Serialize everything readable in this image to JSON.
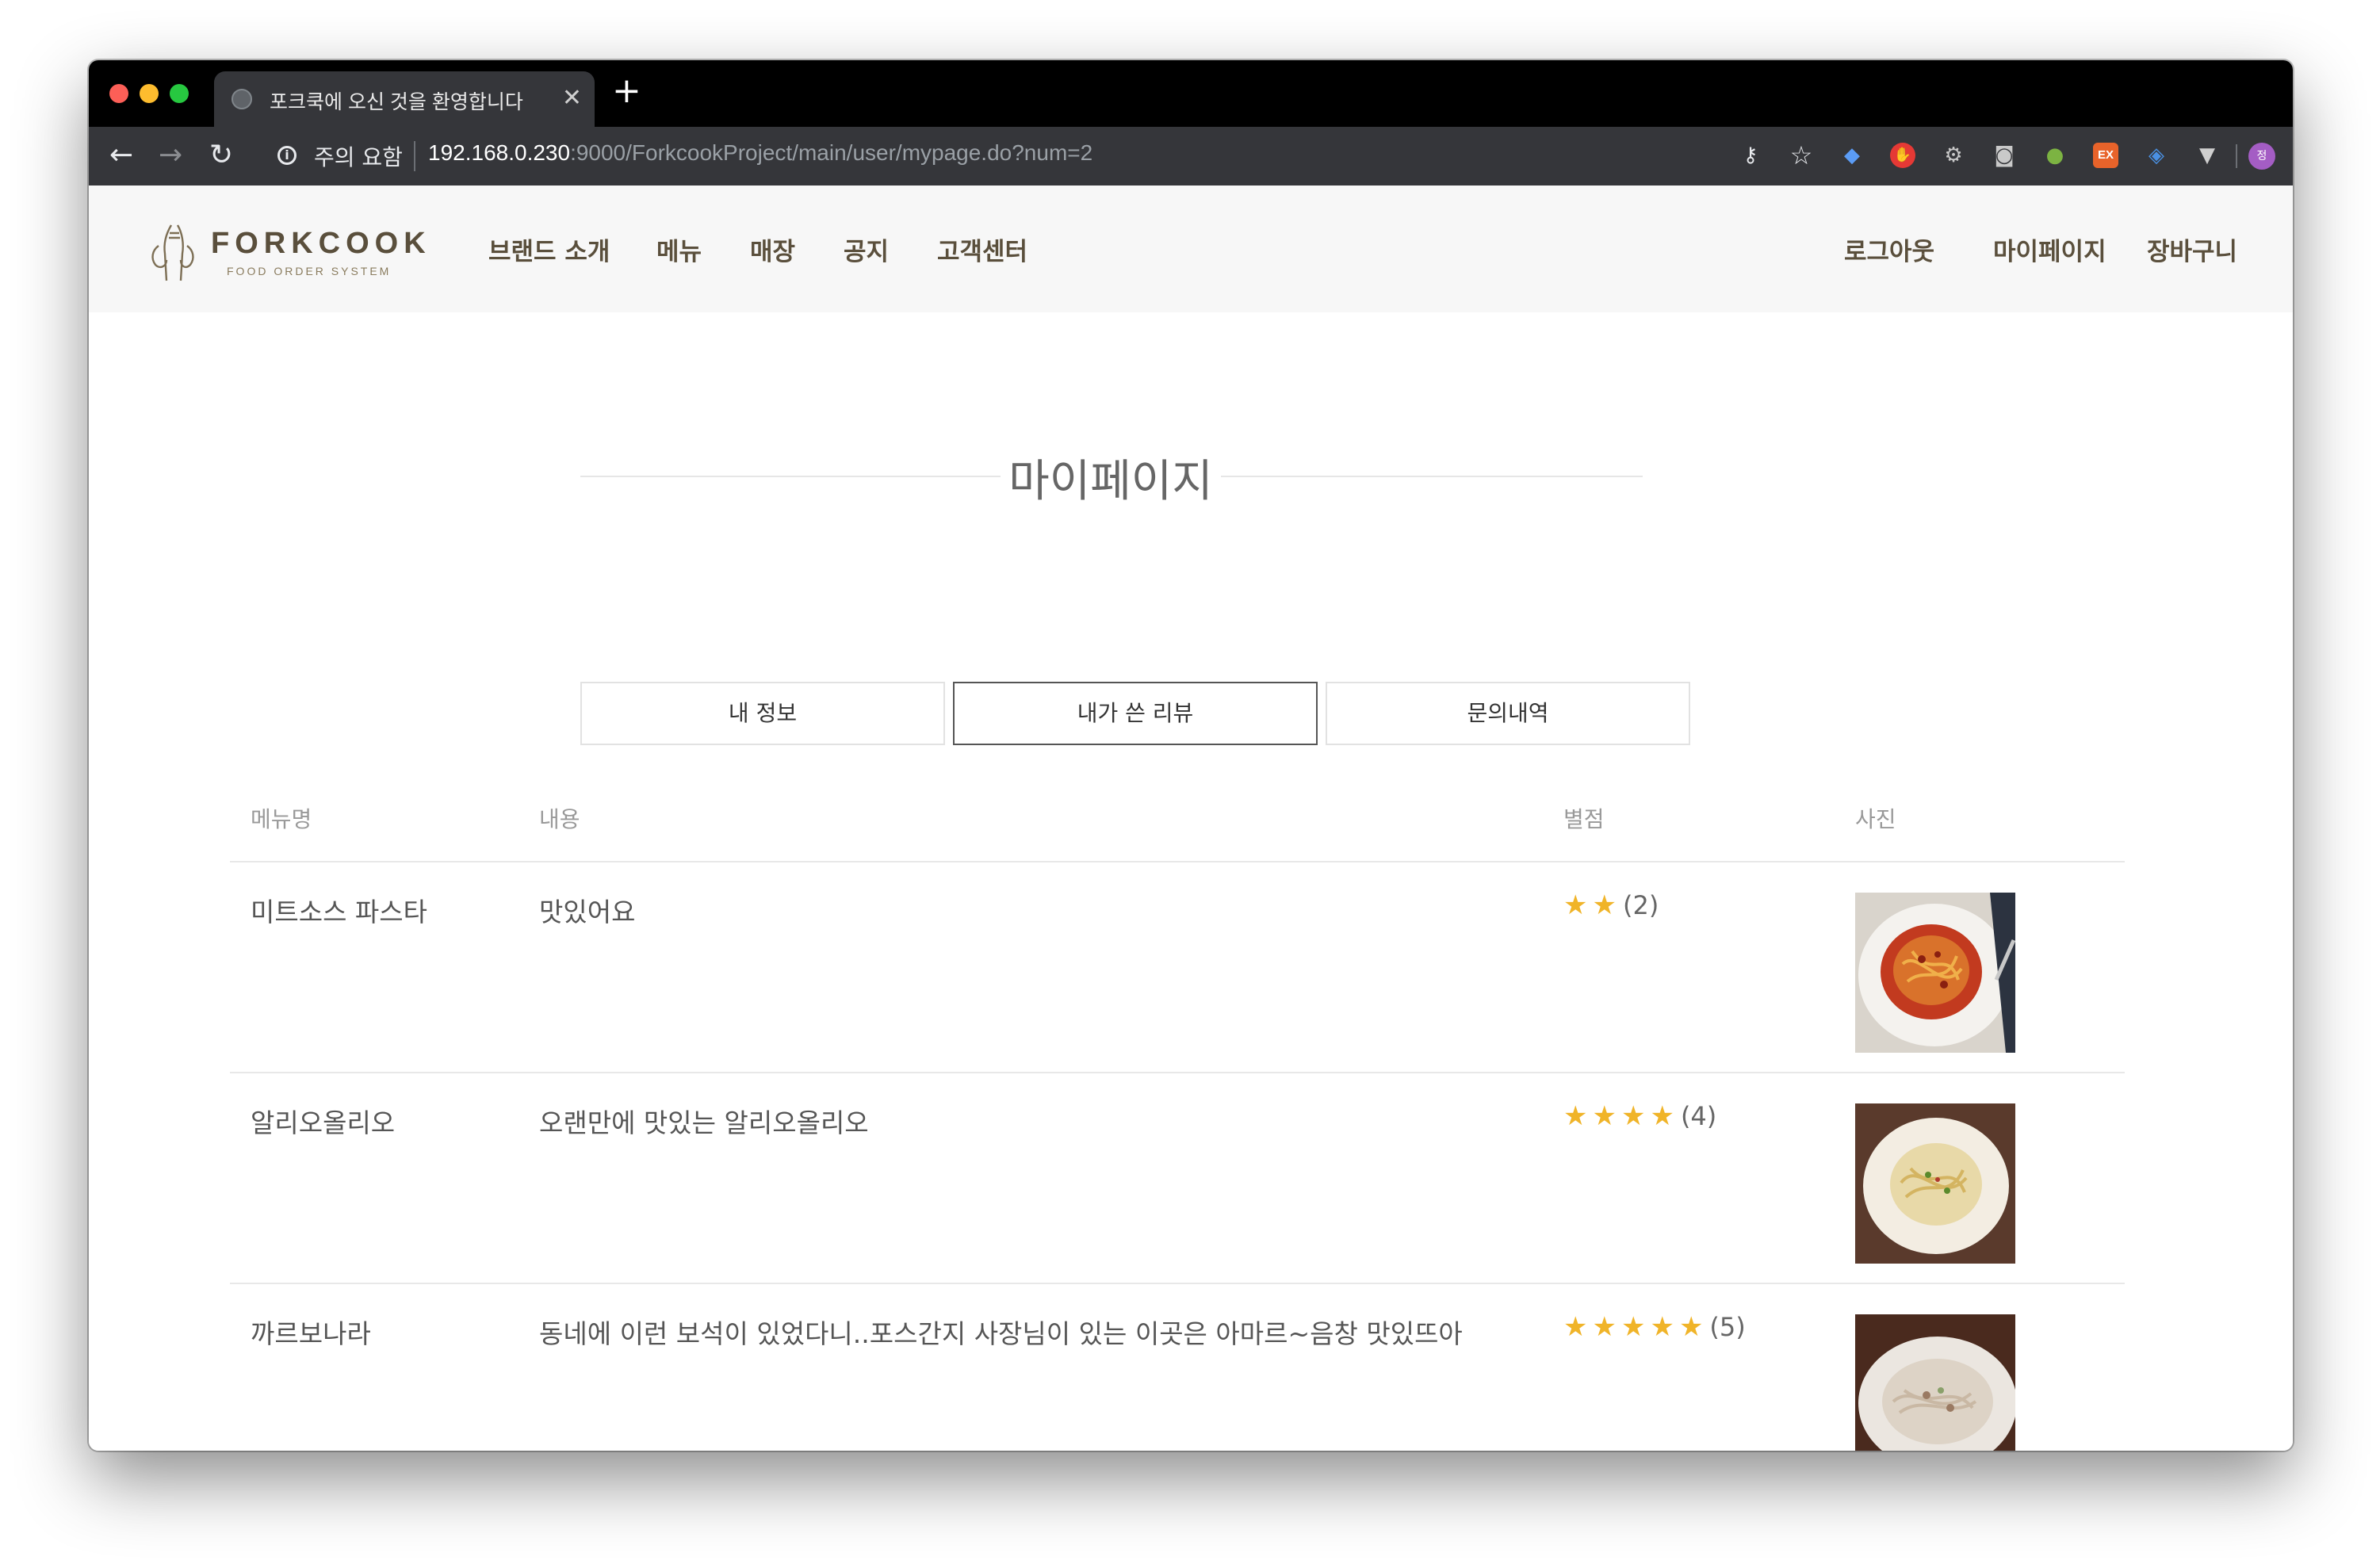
{
  "browser": {
    "tab_title": "포크쿡에 오신 것을 환영합니다",
    "security_label": "주의 요함",
    "url_host": "192.168.0.230",
    "url_rest": ":9000/ForkcookProject/main/user/mypage.do?num=2",
    "profile_initial": "정",
    "ext_badge": "EX"
  },
  "site": {
    "logo_text": "FORKCOOK",
    "logo_sub": "FOOD ORDER SYSTEM",
    "nav_left": [
      "브랜드 소개",
      "메뉴",
      "매장",
      "공지",
      "고객센터"
    ],
    "nav_right": [
      "로그아웃",
      "마이페이지",
      "장바구니"
    ]
  },
  "mypage": {
    "title": "마이페이지",
    "tabs": [
      "내 정보",
      "내가 쓴 리뷰",
      "문의내역"
    ],
    "active_tab": 1,
    "table_headers": [
      "메뉴명",
      "내용",
      "별점",
      "사진"
    ],
    "reviews": [
      {
        "menu": "미트소스 파스타",
        "content": "맛있어요",
        "rating": 2,
        "rating_text": "(2)",
        "photo": "meat-sauce-pasta-photo"
      },
      {
        "menu": "알리오올리오",
        "content": "오랜만에 맛있는 알리오올리오",
        "rating": 4,
        "rating_text": "(4)",
        "photo": "aglio-olio-photo"
      },
      {
        "menu": "까르보나라",
        "content": "동네에 이런 보석이 있었다니..포스간지 사장님이 있는 이곳은 아마르~음창 맛있뜨아",
        "rating": 5,
        "rating_text": "(5)",
        "photo": "carbonara-photo"
      }
    ]
  }
}
